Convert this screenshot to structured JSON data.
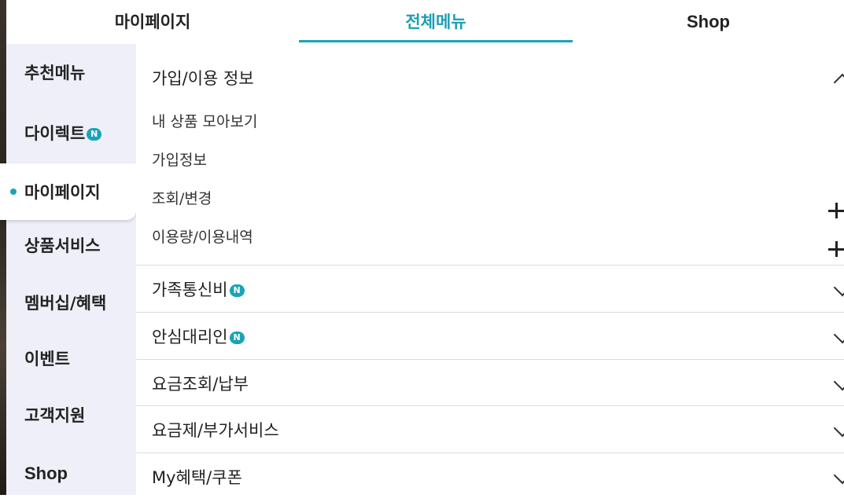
{
  "tabs": [
    {
      "label": "마이페이지"
    },
    {
      "label": "전체메뉴"
    },
    {
      "label": "Shop"
    }
  ],
  "active_tab_color": "#1aa3b8",
  "sidebar": {
    "items": [
      {
        "label": "추천메뉴"
      },
      {
        "label": "다이렉트",
        "badge": "N"
      },
      {
        "label": "마이페이지"
      },
      {
        "label": "상품서비스"
      },
      {
        "label": "멤버십/혜택"
      },
      {
        "label": "이벤트"
      },
      {
        "label": "고객지원"
      },
      {
        "label": "Shop"
      }
    ],
    "active": "마이페이지"
  },
  "content": {
    "expanded_section": {
      "title": "가입/이용 정보",
      "items": [
        {
          "label": "내 상품 모아보기"
        },
        {
          "label": "가입정보"
        },
        {
          "label": "조회/변경"
        },
        {
          "label": "이용량/이용내역"
        }
      ]
    },
    "sections": [
      {
        "title": "가족통신비",
        "badge": "N"
      },
      {
        "title": "안심대리인",
        "badge": "N"
      },
      {
        "title": "요금조회/납부"
      },
      {
        "title": "요금제/부가서비스"
      },
      {
        "title": "My혜택/쿠폰"
      }
    ]
  },
  "icons": {
    "expanded": "chevron-up-icon",
    "collapsed": "chevron-down-icon",
    "expand_sub": "plus-icon",
    "new_badge": "new-badge"
  }
}
